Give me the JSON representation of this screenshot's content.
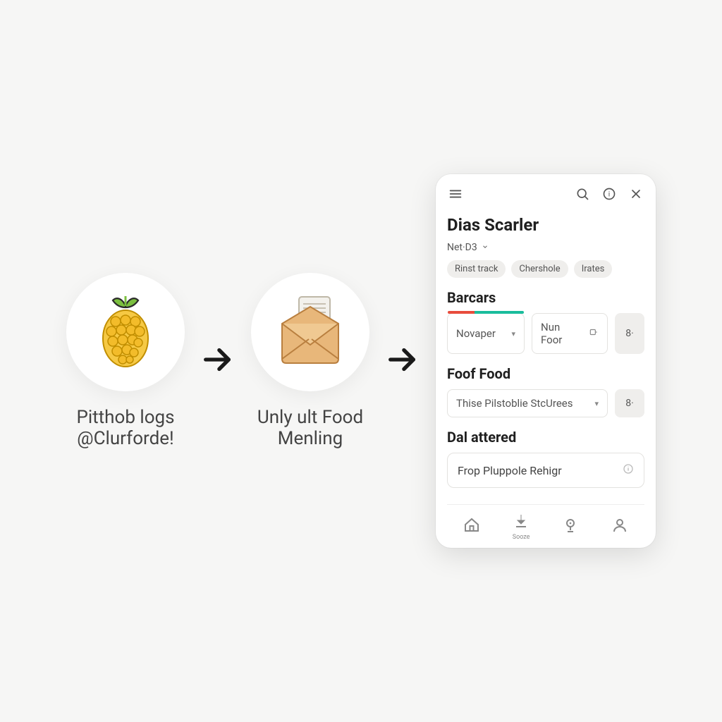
{
  "steps": [
    {
      "label_line1": "Pitthob logs",
      "label_line2": "@Clurforde!"
    },
    {
      "label_line1": "Unly ult Food",
      "label_line2": "Menling"
    }
  ],
  "phone": {
    "title": "Dias Scarler",
    "net_label": "Net·D3",
    "chips": [
      "Rinst track",
      "Chershole",
      "Irates"
    ],
    "section_barcars": {
      "title": "Barcars",
      "select1": "Novaper",
      "select2": "Nun Foor",
      "square_label": "8"
    },
    "section_food": {
      "title": "Foof Food",
      "select": "Thise Pilstoblie StcUrees",
      "square_label": "8"
    },
    "section_dal": {
      "title": "Dal attered",
      "item": "Frop Pluppole Rehigr"
    },
    "nav_download_label": "Sooze"
  }
}
